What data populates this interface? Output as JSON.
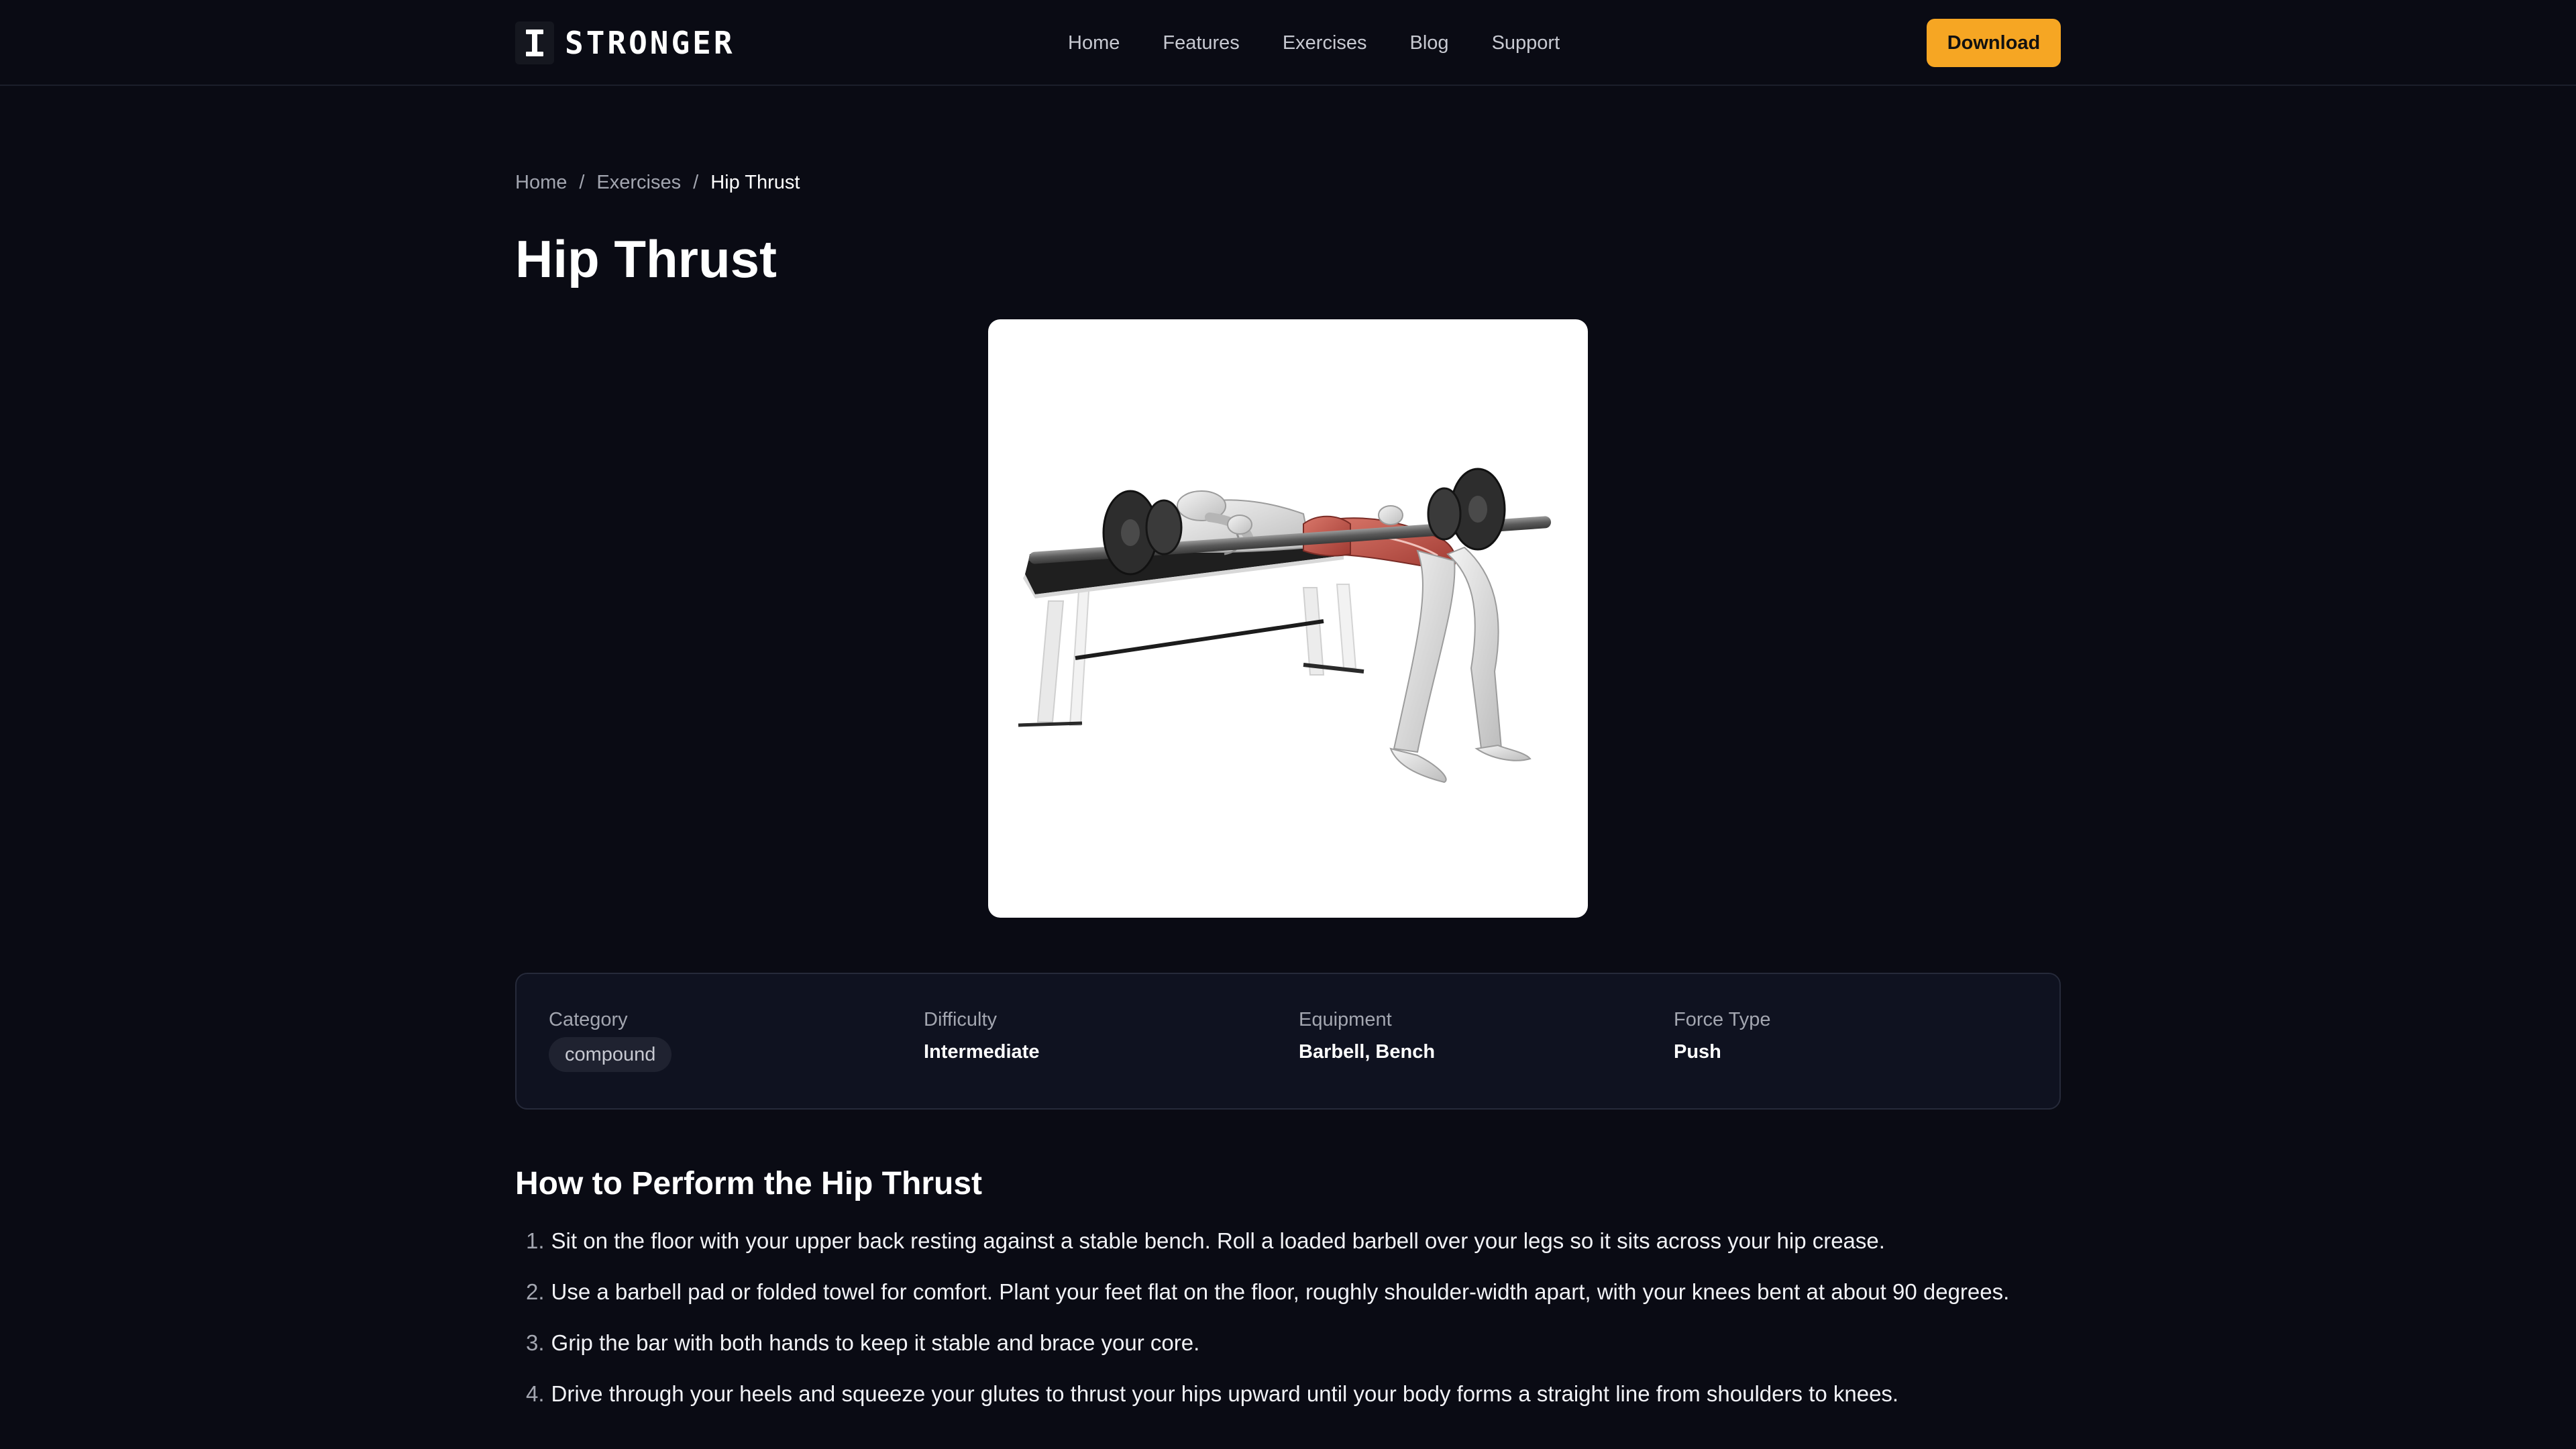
{
  "brand": {
    "name": "STRONGER",
    "logo_icon": "dumbbell-icon"
  },
  "nav": {
    "links": [
      "Home",
      "Features",
      "Exercises",
      "Blog",
      "Support"
    ],
    "download_label": "Download"
  },
  "breadcrumb": {
    "items": [
      "Home",
      "Exercises",
      "Hip Thrust"
    ],
    "separator": "/"
  },
  "page": {
    "title": "Hip Thrust"
  },
  "image": {
    "subject": "barbell-hip-thrust-illustration"
  },
  "info": {
    "category_label": "Category",
    "category_value": "compound",
    "difficulty_label": "Difficulty",
    "difficulty_value": "Intermediate",
    "equipment_label": "Equipment",
    "equipment_value": "Barbell, Bench",
    "force_label": "Force Type",
    "force_value": "Push"
  },
  "instructions": {
    "title": "How to Perform the Hip Thrust",
    "steps": [
      {
        "num": "1.",
        "text": "Sit on the floor with your upper back resting against a stable bench. Roll a loaded barbell over your legs so it sits across your hip crease."
      },
      {
        "num": "2.",
        "text": "Use a barbell pad or folded towel for comfort. Plant your feet flat on the floor, roughly shoulder-width apart, with your knees bent at about 90 degrees."
      },
      {
        "num": "3.",
        "text": "Grip the bar with both hands to keep it stable and brace your core."
      },
      {
        "num": "4.",
        "text": "Drive through your heels and squeeze your glutes to thrust your hips upward until your body forms a straight line from shoulders to knees."
      }
    ]
  },
  "colors": {
    "background": "#0a0b14",
    "accent": "#f6a623",
    "panel": "#0f1220",
    "muted_text": "#a3a6b0"
  }
}
